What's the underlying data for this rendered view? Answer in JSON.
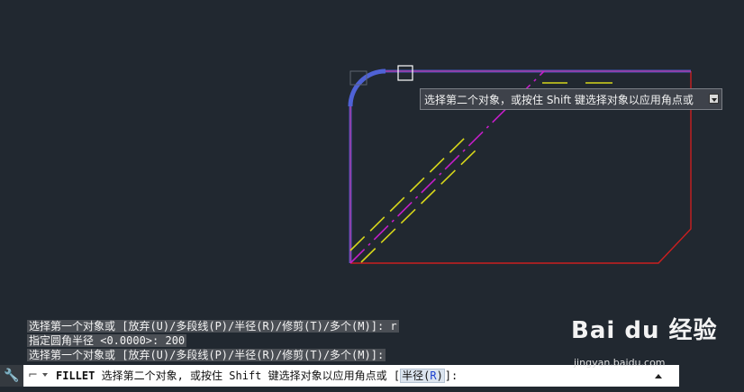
{
  "tooltip": {
    "text": "选择第二个对象，或按住 Shift 键选择对象以应用角点或",
    "options_icon": "dropdown-arrow-icon"
  },
  "history": [
    "选择第一个对象或 [放弃(U)/多段线(P)/半径(R)/修剪(T)/多个(M)]: r",
    "指定圆角半径 <0.0000>: 200",
    "选择第一个对象或 [放弃(U)/多段线(P)/半径(R)/修剪(T)/多个(M)]:"
  ],
  "command_line": {
    "command": "FILLET",
    "prompt": "选择第二个对象, 或按住 Shift 键选择对象以应用角点或",
    "option_open": "[",
    "option_label": "半径(",
    "option_key": "R",
    "option_close": ")",
    "suffix": "]:",
    "settings_icon": "wrench-icon",
    "command_icon": "command-prompt-icon",
    "history_toggle_icon": "up-arrow-icon"
  },
  "watermark": {
    "brand": "Bai du 经验",
    "url": "jingyan.baidu.com"
  },
  "colors": {
    "background": "#212830",
    "outline_red": "#cc1f1f",
    "highlight_blue": "#4557c4",
    "magenta": "#c41ec8",
    "yellow": "#d6d61b"
  }
}
